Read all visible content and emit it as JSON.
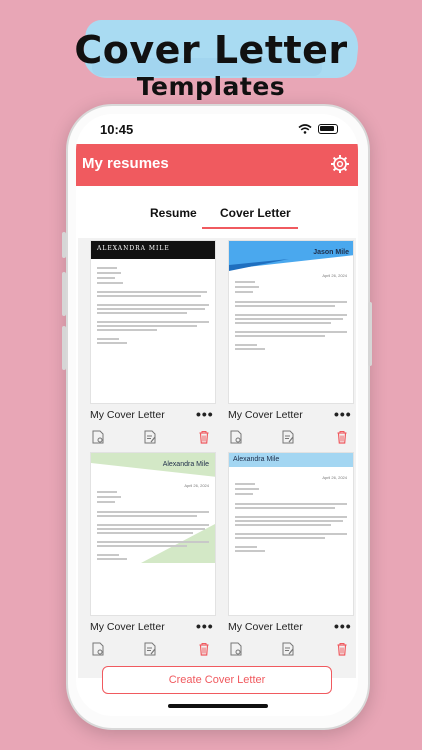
{
  "headline": {
    "title": "Cover Letter",
    "subtitle": "Templates"
  },
  "status_bar": {
    "time": "10:45"
  },
  "app_bar": {
    "title": "My resumes"
  },
  "tabs": [
    {
      "label": "Resume"
    },
    {
      "label": "Cover Letter",
      "selected": true
    }
  ],
  "cards": [
    {
      "title": "My Cover Letter",
      "name": "ALEXANDRA MILE",
      "date": "April 26, 2024"
    },
    {
      "title": "My Cover Letter",
      "name": "Jason Mile",
      "date": "April 26, 2024"
    },
    {
      "title": "My Cover Letter",
      "name": "Alexandra Mile",
      "date": "April 26, 2024"
    },
    {
      "title": "My Cover Letter",
      "name": "Alexandra Mile",
      "date": "April 26, 2024"
    }
  ],
  "card_menu_glyph": "•••",
  "create_button": {
    "label": "Create Cover Letter"
  },
  "colors": {
    "accent": "#f05a5f",
    "background": "#e8a6b6",
    "banner": "#a9dbf2",
    "template_blue": "#4aa8ee",
    "template_green": "#d3e8c6",
    "template_lightblue": "#a3d6f2"
  }
}
